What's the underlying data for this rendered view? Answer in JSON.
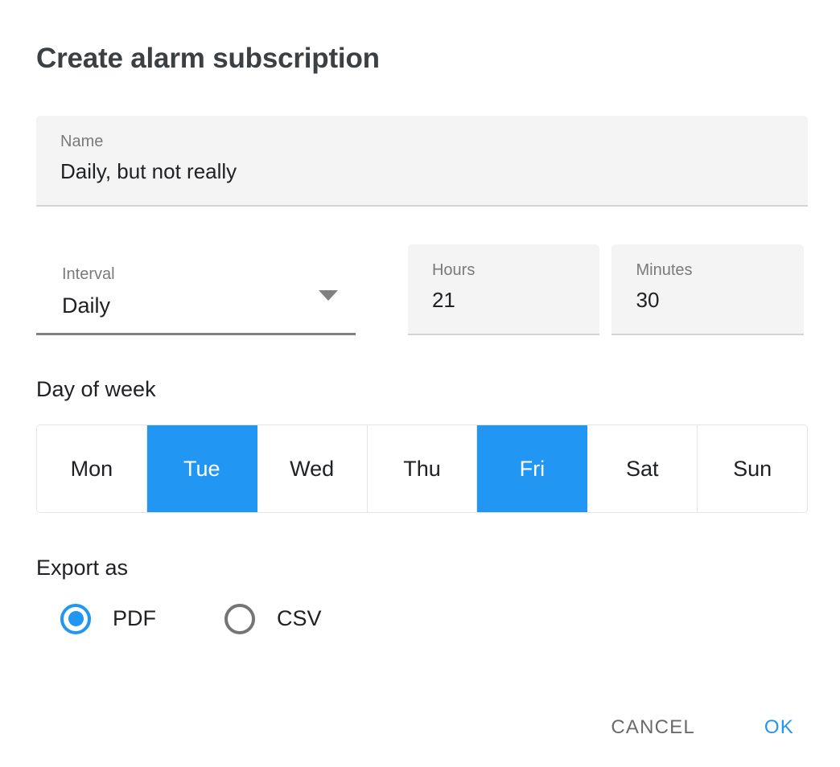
{
  "dialog": {
    "title": "Create alarm subscription"
  },
  "name_field": {
    "label": "Name",
    "value": "Daily, but not really",
    "placeholder": "Name"
  },
  "interval_field": {
    "label": "Interval",
    "value": "Daily",
    "arrow_icon": "chevron-down-icon"
  },
  "hours_field": {
    "label": "Hours",
    "value": "21",
    "placeholder": "Hours"
  },
  "minutes_field": {
    "label": "Minutes",
    "value": "30",
    "placeholder": "Minutes"
  },
  "day_of_week": {
    "label": "Day of week",
    "days": [
      {
        "label": "Mon",
        "selected": false
      },
      {
        "label": "Tue",
        "selected": true
      },
      {
        "label": "Wed",
        "selected": false
      },
      {
        "label": "Thu",
        "selected": false
      },
      {
        "label": "Fri",
        "selected": true
      },
      {
        "label": "Sat",
        "selected": false
      },
      {
        "label": "Sun",
        "selected": false
      }
    ]
  },
  "export_as": {
    "label": "Export as",
    "options": [
      {
        "label": "PDF",
        "selected": true
      },
      {
        "label": "CSV",
        "selected": false
      }
    ]
  },
  "actions": {
    "cancel_label": "CANCEL",
    "ok_label": "OK"
  },
  "colors": {
    "accent": "#2196f3",
    "title": "#3c4043",
    "text": "#202124",
    "muted": "#7a7a7a",
    "field_fill": "#f4f4f4",
    "border": "#e4e4e4",
    "cancel": "#6b6b6b"
  }
}
